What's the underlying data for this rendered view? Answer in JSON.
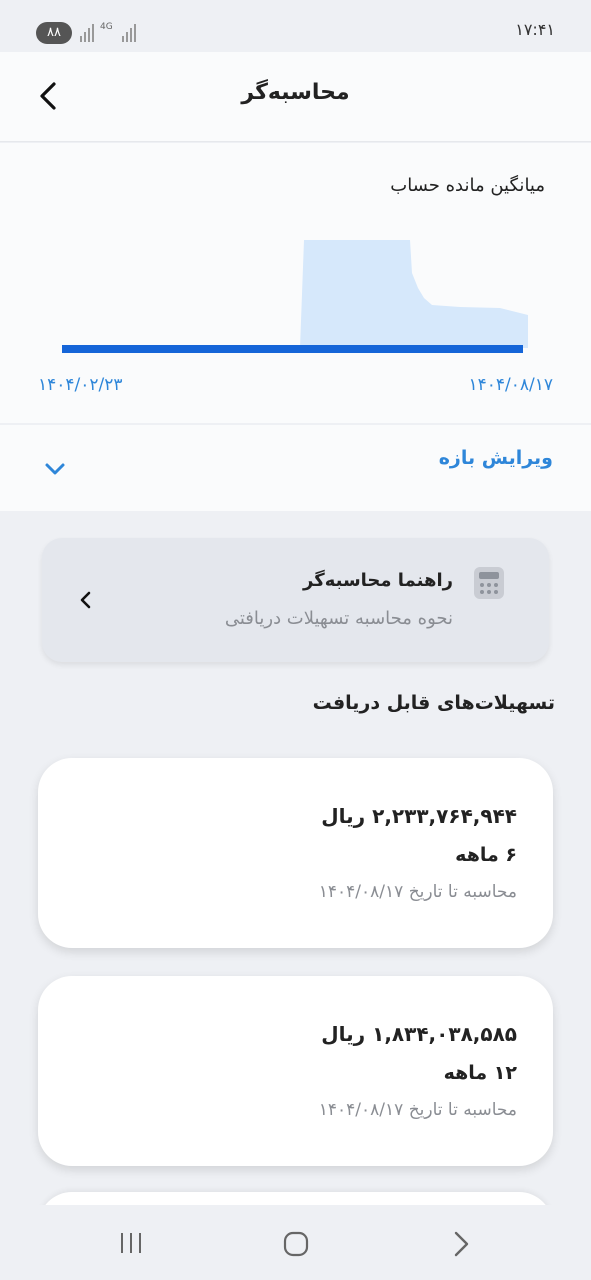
{
  "status_bar": {
    "time": "۱۷:۴۱",
    "battery": "۸۸",
    "network": "4G"
  },
  "header": {
    "title": "محاسبه‌گر",
    "back_icon": "chevron-left-icon"
  },
  "chart": {
    "title": "میانگین مانده حساب",
    "start_date": "۱۴۰۴/۰۲/۲۳",
    "end_date": "۱۴۰۴/۰۸/۱۷",
    "line_color": "#1565d8",
    "area_color": "#d6e8fb"
  },
  "range": {
    "label": "ویرایش بازه",
    "icon": "chevron-down-icon"
  },
  "guide": {
    "title": "راهنما محاسبه‌گر",
    "subtitle": "نحوه محاسبه تسهیلات دریافتی",
    "icon": "calculator-icon"
  },
  "loans_section": {
    "title": "تسهیلات‌های قابل دریافت"
  },
  "loans": [
    {
      "amount": "۲,۲۳۳,۷۶۴,۹۴۴ ریال",
      "term": "۶ ماهه",
      "date_note": "محاسبه تا تاریخ ۱۴۰۴/۰۸/۱۷"
    },
    {
      "amount": "۱,۸۳۴,۰۳۸,۵۸۵ ریال",
      "term": "۱۲ ماهه",
      "date_note": "محاسبه تا تاریخ ۱۴۰۴/۰۸/۱۷"
    }
  ],
  "colors": {
    "accent": "#2e86d9",
    "background": "#eef0f4"
  }
}
